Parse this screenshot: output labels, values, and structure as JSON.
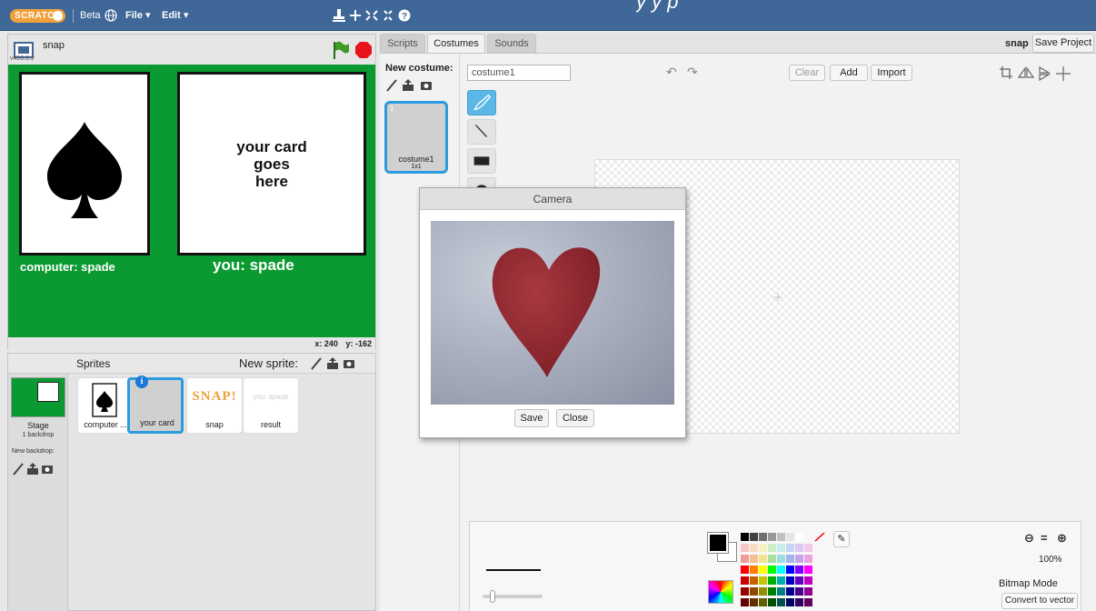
{
  "menubar": {
    "logo": "SCRATCH",
    "beta": "Beta",
    "file": "File ▾",
    "edit": "Edit ▾",
    "overlay_text": "y     y     p"
  },
  "stage": {
    "project_name": "snap",
    "version": "v456.0.2",
    "card_text": "your card\ngoes\nhere",
    "computer_label": "computer:  spade",
    "you_label": "you: spade",
    "x_label": "x:",
    "x_value": "240",
    "y_label": "y:",
    "y_value": "-162"
  },
  "sprites": {
    "title": "Sprites",
    "new_sprite": "New sprite:",
    "stage_name": "Stage",
    "stage_backdrops": "1 backdrop",
    "new_backdrop": "New backdrop:",
    "items": [
      {
        "name": "computer ..."
      },
      {
        "name": "your card"
      },
      {
        "name": "snap",
        "thumb": "SNAP!"
      },
      {
        "name": "result",
        "thumb": "you: spade"
      }
    ]
  },
  "tabs": {
    "scripts": "Scripts",
    "costumes": "Costumes",
    "sounds": "Sounds"
  },
  "header": {
    "user": "snap",
    "save_project": "Save Project"
  },
  "costumes": {
    "new_costume": "New costume:",
    "items": [
      {
        "number": "1",
        "name": "costume1",
        "size": "1x1"
      }
    ]
  },
  "paint": {
    "costume_name_value": "costume1",
    "clear": "Clear",
    "add": "Add",
    "import": "Import",
    "zoom": "100%",
    "mode": "Bitmap Mode",
    "convert": "Convert to vector"
  },
  "camera": {
    "title": "Camera",
    "save": "Save",
    "close": "Close"
  },
  "colors": {
    "menubar": "#3f6797",
    "stage_green": "#0b9a32",
    "selection_blue": "#2b9be0",
    "stop_red": "#e8141b",
    "heart_red": "#9c2a32"
  }
}
